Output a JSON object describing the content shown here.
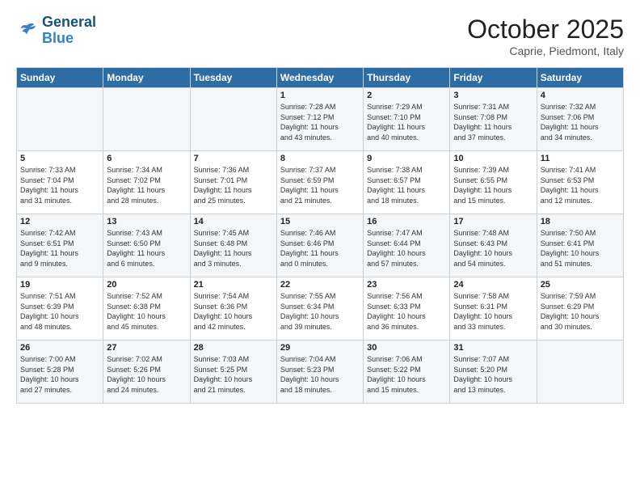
{
  "header": {
    "logo_line1": "General",
    "logo_line2": "Blue",
    "month": "October 2025",
    "location": "Caprie, Piedmont, Italy"
  },
  "days_of_week": [
    "Sunday",
    "Monday",
    "Tuesday",
    "Wednesday",
    "Thursday",
    "Friday",
    "Saturday"
  ],
  "weeks": [
    [
      {
        "day": "",
        "content": ""
      },
      {
        "day": "",
        "content": ""
      },
      {
        "day": "",
        "content": ""
      },
      {
        "day": "1",
        "content": "Sunrise: 7:28 AM\nSunset: 7:12 PM\nDaylight: 11 hours\nand 43 minutes."
      },
      {
        "day": "2",
        "content": "Sunrise: 7:29 AM\nSunset: 7:10 PM\nDaylight: 11 hours\nand 40 minutes."
      },
      {
        "day": "3",
        "content": "Sunrise: 7:31 AM\nSunset: 7:08 PM\nDaylight: 11 hours\nand 37 minutes."
      },
      {
        "day": "4",
        "content": "Sunrise: 7:32 AM\nSunset: 7:06 PM\nDaylight: 11 hours\nand 34 minutes."
      }
    ],
    [
      {
        "day": "5",
        "content": "Sunrise: 7:33 AM\nSunset: 7:04 PM\nDaylight: 11 hours\nand 31 minutes."
      },
      {
        "day": "6",
        "content": "Sunrise: 7:34 AM\nSunset: 7:02 PM\nDaylight: 11 hours\nand 28 minutes."
      },
      {
        "day": "7",
        "content": "Sunrise: 7:36 AM\nSunset: 7:01 PM\nDaylight: 11 hours\nand 25 minutes."
      },
      {
        "day": "8",
        "content": "Sunrise: 7:37 AM\nSunset: 6:59 PM\nDaylight: 11 hours\nand 21 minutes."
      },
      {
        "day": "9",
        "content": "Sunrise: 7:38 AM\nSunset: 6:57 PM\nDaylight: 11 hours\nand 18 minutes."
      },
      {
        "day": "10",
        "content": "Sunrise: 7:39 AM\nSunset: 6:55 PM\nDaylight: 11 hours\nand 15 minutes."
      },
      {
        "day": "11",
        "content": "Sunrise: 7:41 AM\nSunset: 6:53 PM\nDaylight: 11 hours\nand 12 minutes."
      }
    ],
    [
      {
        "day": "12",
        "content": "Sunrise: 7:42 AM\nSunset: 6:51 PM\nDaylight: 11 hours\nand 9 minutes."
      },
      {
        "day": "13",
        "content": "Sunrise: 7:43 AM\nSunset: 6:50 PM\nDaylight: 11 hours\nand 6 minutes."
      },
      {
        "day": "14",
        "content": "Sunrise: 7:45 AM\nSunset: 6:48 PM\nDaylight: 11 hours\nand 3 minutes."
      },
      {
        "day": "15",
        "content": "Sunrise: 7:46 AM\nSunset: 6:46 PM\nDaylight: 11 hours\nand 0 minutes."
      },
      {
        "day": "16",
        "content": "Sunrise: 7:47 AM\nSunset: 6:44 PM\nDaylight: 10 hours\nand 57 minutes."
      },
      {
        "day": "17",
        "content": "Sunrise: 7:48 AM\nSunset: 6:43 PM\nDaylight: 10 hours\nand 54 minutes."
      },
      {
        "day": "18",
        "content": "Sunrise: 7:50 AM\nSunset: 6:41 PM\nDaylight: 10 hours\nand 51 minutes."
      }
    ],
    [
      {
        "day": "19",
        "content": "Sunrise: 7:51 AM\nSunset: 6:39 PM\nDaylight: 10 hours\nand 48 minutes."
      },
      {
        "day": "20",
        "content": "Sunrise: 7:52 AM\nSunset: 6:38 PM\nDaylight: 10 hours\nand 45 minutes."
      },
      {
        "day": "21",
        "content": "Sunrise: 7:54 AM\nSunset: 6:36 PM\nDaylight: 10 hours\nand 42 minutes."
      },
      {
        "day": "22",
        "content": "Sunrise: 7:55 AM\nSunset: 6:34 PM\nDaylight: 10 hours\nand 39 minutes."
      },
      {
        "day": "23",
        "content": "Sunrise: 7:56 AM\nSunset: 6:33 PM\nDaylight: 10 hours\nand 36 minutes."
      },
      {
        "day": "24",
        "content": "Sunrise: 7:58 AM\nSunset: 6:31 PM\nDaylight: 10 hours\nand 33 minutes."
      },
      {
        "day": "25",
        "content": "Sunrise: 7:59 AM\nSunset: 6:29 PM\nDaylight: 10 hours\nand 30 minutes."
      }
    ],
    [
      {
        "day": "26",
        "content": "Sunrise: 7:00 AM\nSunset: 5:28 PM\nDaylight: 10 hours\nand 27 minutes."
      },
      {
        "day": "27",
        "content": "Sunrise: 7:02 AM\nSunset: 5:26 PM\nDaylight: 10 hours\nand 24 minutes."
      },
      {
        "day": "28",
        "content": "Sunrise: 7:03 AM\nSunset: 5:25 PM\nDaylight: 10 hours\nand 21 minutes."
      },
      {
        "day": "29",
        "content": "Sunrise: 7:04 AM\nSunset: 5:23 PM\nDaylight: 10 hours\nand 18 minutes."
      },
      {
        "day": "30",
        "content": "Sunrise: 7:06 AM\nSunset: 5:22 PM\nDaylight: 10 hours\nand 15 minutes."
      },
      {
        "day": "31",
        "content": "Sunrise: 7:07 AM\nSunset: 5:20 PM\nDaylight: 10 hours\nand 13 minutes."
      },
      {
        "day": "",
        "content": ""
      }
    ]
  ]
}
